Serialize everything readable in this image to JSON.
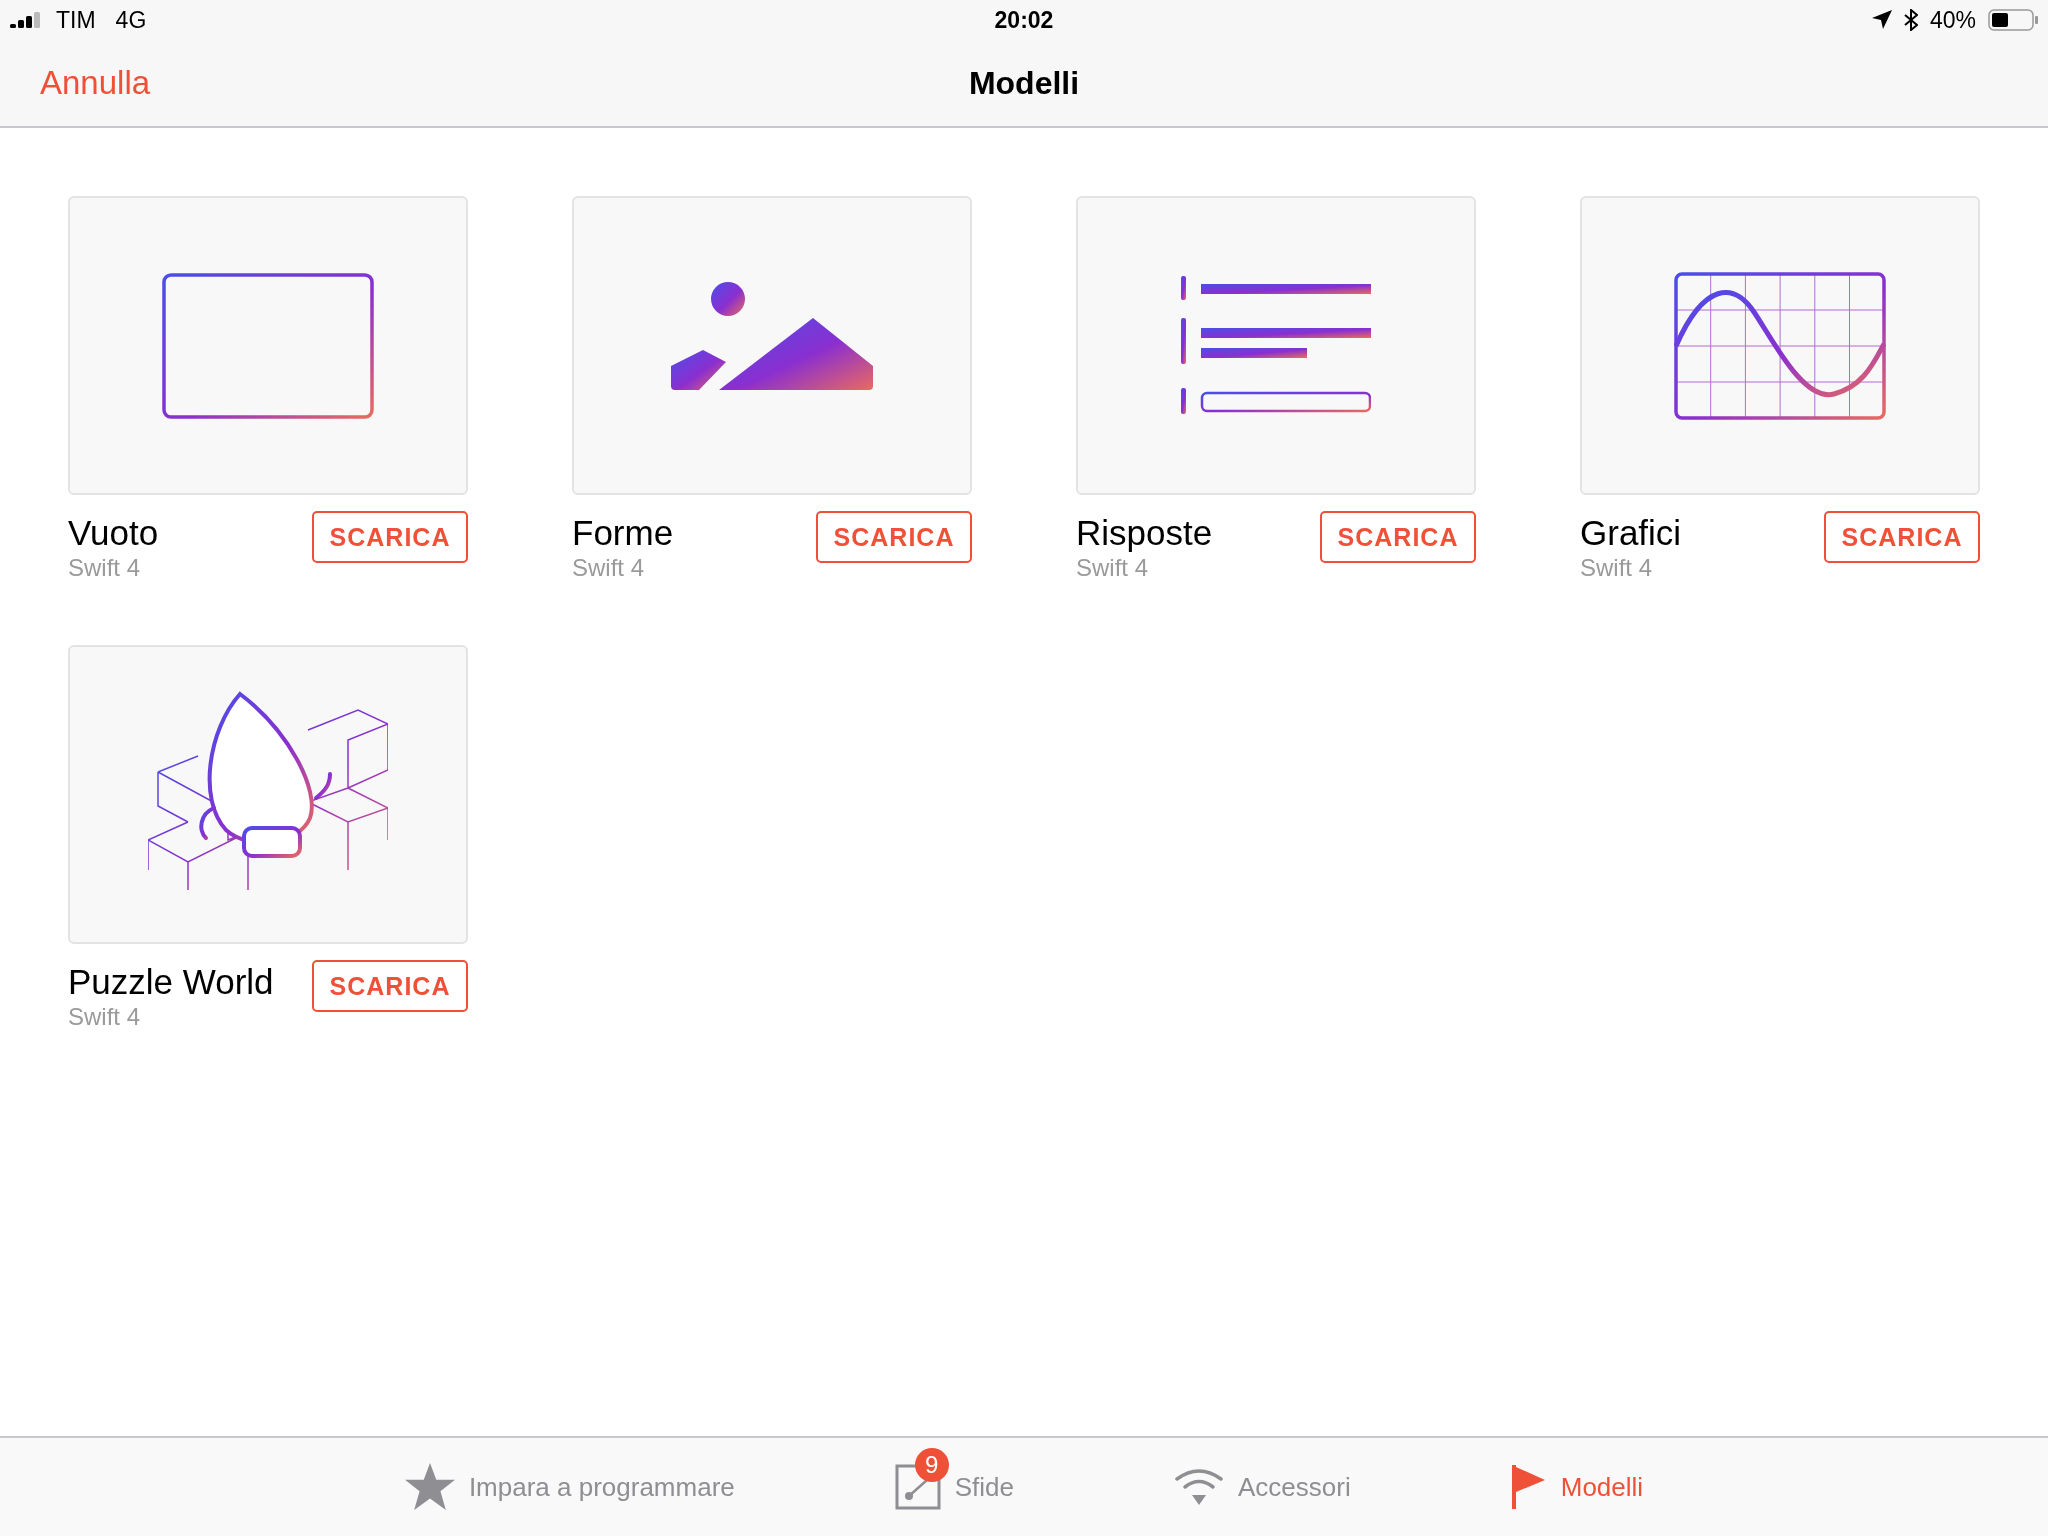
{
  "status_bar": {
    "carrier": "TIM",
    "network": "4G",
    "time": "20:02",
    "battery": "40%"
  },
  "nav_bar": {
    "cancel": "Annulla",
    "title": "Modelli"
  },
  "templates": [
    {
      "kind": "blank",
      "title": "Vuoto",
      "subtitle": "Swift 4",
      "button": "SCARICA"
    },
    {
      "kind": "shapes",
      "title": "Forme",
      "subtitle": "Swift 4",
      "button": "SCARICA"
    },
    {
      "kind": "answers",
      "title": "Risposte",
      "subtitle": "Swift 4",
      "button": "SCARICA"
    },
    {
      "kind": "charts",
      "title": "Grafici",
      "subtitle": "Swift 4",
      "button": "SCARICA"
    },
    {
      "kind": "puzzle",
      "title": "Puzzle World",
      "subtitle": "Swift 4",
      "button": "SCARICA"
    }
  ],
  "tab_bar": [
    {
      "kind": "star",
      "label": "Impara a programmare",
      "selected": false
    },
    {
      "kind": "challenges",
      "label": "Sfide",
      "badge": "9",
      "selected": false
    },
    {
      "kind": "wifi",
      "label": "Accessori",
      "selected": false
    },
    {
      "kind": "flag",
      "label": "Modelli",
      "selected": true
    }
  ]
}
